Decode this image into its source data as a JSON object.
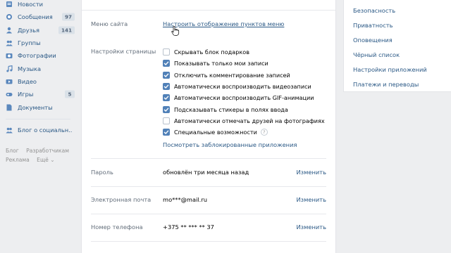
{
  "nav": {
    "items": [
      {
        "label": "Новости",
        "icon": "news-icon",
        "count": ""
      },
      {
        "label": "Сообщения",
        "icon": "messages-icon",
        "count": "97"
      },
      {
        "label": "Друзья",
        "icon": "friends-icon",
        "count": "141"
      },
      {
        "label": "Группы",
        "icon": "groups-icon",
        "count": ""
      },
      {
        "label": "Фотографии",
        "icon": "photos-icon",
        "count": ""
      },
      {
        "label": "Музыка",
        "icon": "music-icon",
        "count": ""
      },
      {
        "label": "Видео",
        "icon": "video-icon",
        "count": ""
      },
      {
        "label": "Игры",
        "icon": "games-icon",
        "count": "5"
      },
      {
        "label": "Документы",
        "icon": "documents-icon",
        "count": ""
      }
    ],
    "extra": {
      "label": "Блог о социальн..",
      "icon": "group-icon"
    },
    "footer": [
      "Блог",
      "Разработчикам",
      "Реклама",
      "Ещё ⌄"
    ]
  },
  "settings": {
    "menu": {
      "label": "Меню сайта",
      "link": "Настроить отображение пунктов меню"
    },
    "page": {
      "label": "Настройки страницы",
      "options": [
        {
          "text": "Скрывать блок подарков",
          "checked": false
        },
        {
          "text": "Показывать только мои записи",
          "checked": true
        },
        {
          "text": "Отключить комментирование записей",
          "checked": true
        },
        {
          "text": "Автоматически воспроизводить видеозаписи",
          "checked": true
        },
        {
          "text": "Автоматически воспроизводить GIF-анимации",
          "checked": true
        },
        {
          "text": "Подсказывать стикеры в полях ввода",
          "checked": true
        },
        {
          "text": "Автоматически отмечать друзей на фотографиях",
          "checked": false
        },
        {
          "text": "Специальные возможности",
          "checked": true,
          "help": "?"
        }
      ],
      "blocked_link": "Посмотреть заблокированные приложения"
    },
    "password": {
      "label": "Пароль",
      "value": "обновлён три месяца назад",
      "action": "Изменить"
    },
    "email": {
      "label": "Электронная почта",
      "value": "mo***@mail.ru",
      "action": "Изменить"
    },
    "phone": {
      "label": "Номер телефона",
      "value": "+375 ** *** ** 37",
      "action": "Изменить"
    }
  },
  "right_menu": [
    "Безопасность",
    "Приватность",
    "Оповещения",
    "Чёрный список",
    "Настройки приложений",
    "Платежи и переводы"
  ],
  "colors": {
    "link": "#2a5885",
    "checkbox": "#5181b8",
    "background": "#edeef0"
  }
}
